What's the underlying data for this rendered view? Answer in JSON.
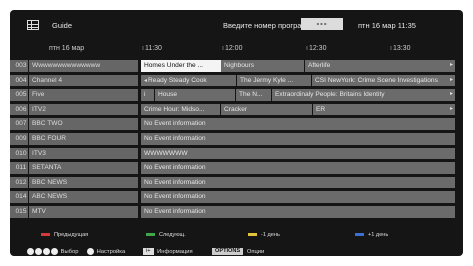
{
  "header": {
    "title": "Guide",
    "prompt": "Введите номер программы",
    "input_value": "---",
    "datetime": "птн  16  мар 11:35"
  },
  "timeline": {
    "date": "птн  16  мар",
    "ticks": [
      "11:30",
      "12:00",
      "12:30",
      "13:30"
    ]
  },
  "channels": [
    {
      "number": "003",
      "name": "Wwwwwwwwwwwwww",
      "programs": [
        {
          "title": "Homes Under the ...",
          "selected": true
        },
        {
          "title": "Nighbours"
        },
        {
          "title": "Afterlife",
          "more": true
        }
      ]
    },
    {
      "number": "004",
      "name": "Channel 4",
      "programs": [
        {
          "title": "Ready Steady Cook",
          "prev": true
        },
        {
          "title": "The Jermy Kyle ..."
        },
        {
          "title": "CSI NewYork: Crime Scene Investigations",
          "more": true
        }
      ]
    },
    {
      "number": "005",
      "name": "Five",
      "programs": [
        {
          "title": "i"
        },
        {
          "title": "House"
        },
        {
          "title": "The N..."
        },
        {
          "title": "Extraordinaly People: Britains Identity",
          "more": true
        }
      ]
    },
    {
      "number": "006",
      "name": "ITV2",
      "programs": [
        {
          "title": "Crime Hour: Midso..."
        },
        {
          "title": "Cracker"
        },
        {
          "title": "ER",
          "more": true
        }
      ]
    },
    {
      "number": "007",
      "name": "BBC TWO",
      "programs": [
        {
          "title": "No Event information"
        }
      ]
    },
    {
      "number": "009",
      "name": "BBC FOUR",
      "programs": [
        {
          "title": "No Event information"
        }
      ]
    },
    {
      "number": "010",
      "name": "ITV3",
      "programs": [
        {
          "title": "WWWWWWW"
        }
      ]
    },
    {
      "number": "011",
      "name": "SETANTA",
      "programs": [
        {
          "title": "No Event information"
        }
      ]
    },
    {
      "number": "012",
      "name": "BBC NEWS",
      "programs": [
        {
          "title": "No Event information"
        }
      ]
    },
    {
      "number": "014",
      "name": "ABC NEWS",
      "programs": [
        {
          "title": "No Event information"
        }
      ]
    },
    {
      "number": "015",
      "name": "MTV",
      "programs": [
        {
          "title": "No Event information"
        }
      ]
    }
  ],
  "legend": [
    {
      "label": "Предыдущая",
      "color": "#d23b3b"
    },
    {
      "label": "Следующ.",
      "color": "#3fa64a"
    },
    {
      "label": "-1 день",
      "color": "#e2c23a"
    },
    {
      "label": "+1 день",
      "color": "#3b6fd2"
    }
  ],
  "controls": {
    "select": "Выбор",
    "setup": "Настройка",
    "info_key": "i+",
    "info": "Информация",
    "options_key": "OPTIONS",
    "options": "Опции"
  },
  "colors": {
    "background": "#151515",
    "cell": "#6b6b6b",
    "selected_cell": "#f4f4f4"
  }
}
